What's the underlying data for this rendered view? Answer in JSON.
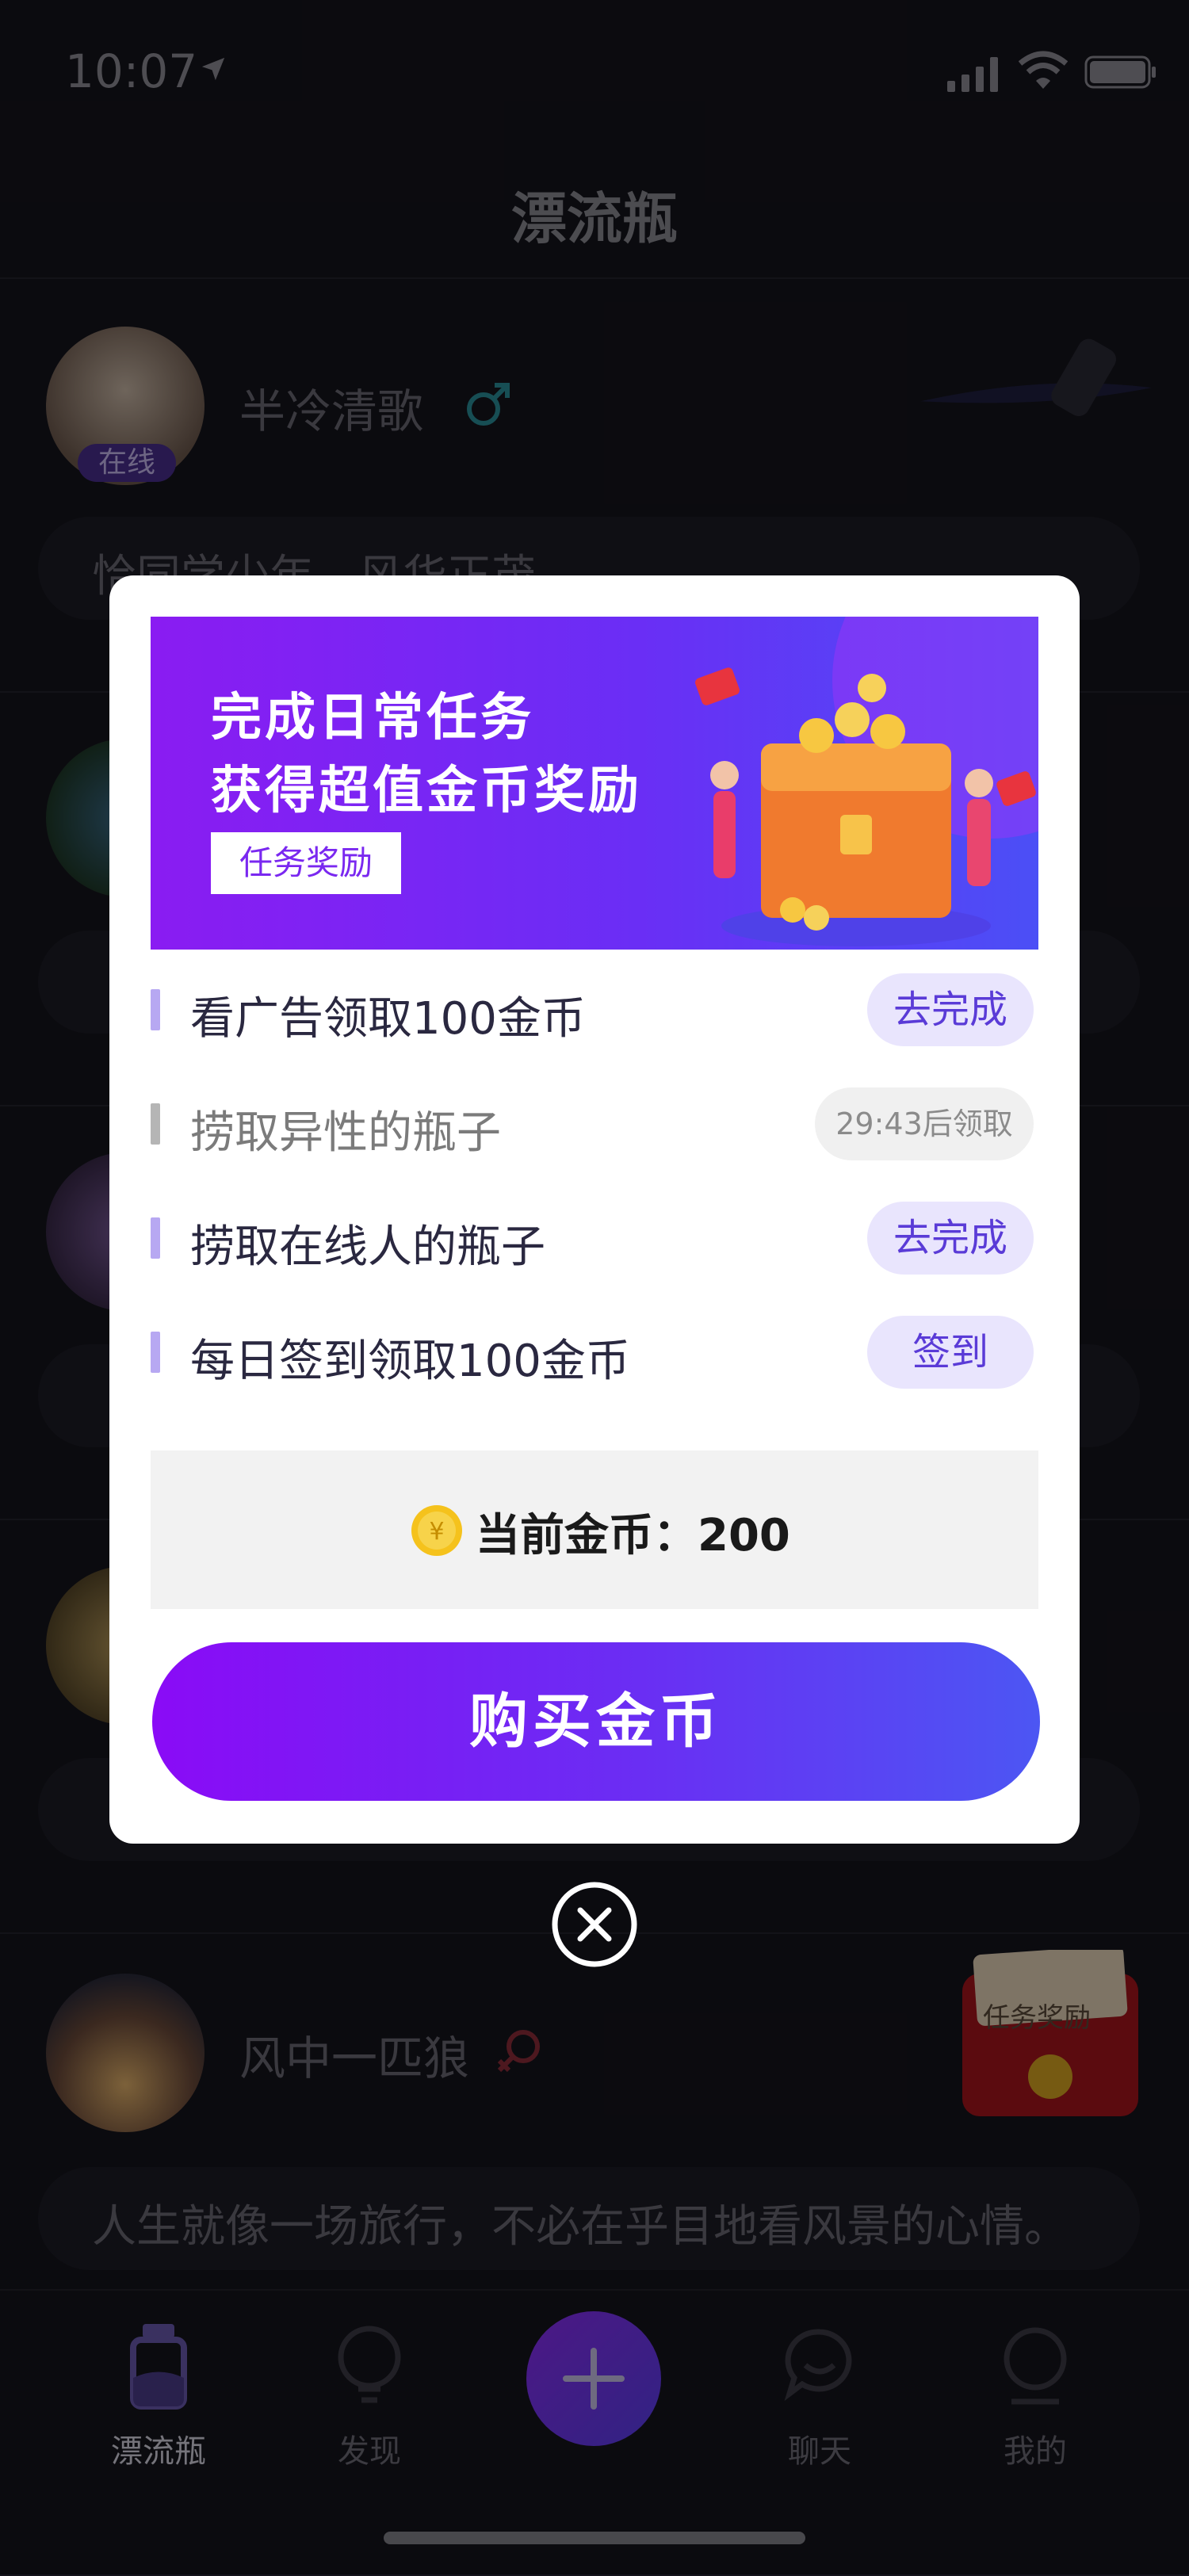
{
  "status_bar": {
    "time": "10:07"
  },
  "nav": {
    "title": "漂流瓶"
  },
  "feed": [
    {
      "username": "半冷清歌",
      "online_badge": "在线",
      "message": "恰同学少年，风华正茂。"
    },
    {
      "username": "",
      "message": ""
    },
    {
      "username": "",
      "message": ""
    },
    {
      "username": "",
      "message": ""
    },
    {
      "username": "风中一匹狼",
      "message": "人生就像一场旅行，不必在乎目地看风景的心情。"
    }
  ],
  "modal": {
    "banner": {
      "line1": "完成日常任务",
      "line2": "获得超值金币奖励",
      "tag": "任务奖励"
    },
    "tasks": [
      {
        "label": "看广告领取100金币",
        "button": "去完成"
      },
      {
        "label": "捞取异性的瓶子",
        "button": "29:43后领取"
      },
      {
        "label": "捞取在线人的瓶子",
        "button": "去完成"
      },
      {
        "label": "每日签到领取100金币",
        "button": "签到"
      }
    ],
    "coins": {
      "label": "当前金币：200"
    },
    "buy_button": "购买金币"
  },
  "red_packet": {
    "label": "任务奖励"
  },
  "tabbar": {
    "items": [
      {
        "label": "漂流瓶",
        "icon": "bottle-icon",
        "active": true
      },
      {
        "label": "发现",
        "icon": "bulb-icon",
        "active": false
      },
      {
        "label": "聊天",
        "icon": "chat-icon",
        "active": false
      },
      {
        "label": "我的",
        "icon": "profile-icon",
        "active": false
      }
    ]
  },
  "colors": {
    "accent": "#6a2ef5",
    "male": "#2fc1d4",
    "female": "#e0445a"
  }
}
